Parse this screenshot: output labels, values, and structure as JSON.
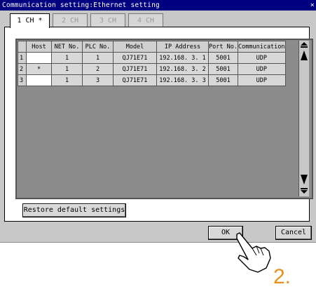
{
  "window": {
    "title": "Communication setting:Ethernet setting",
    "close_glyph": "×"
  },
  "tabs": [
    {
      "label": "1 CH *",
      "active": true
    },
    {
      "label": "2 CH",
      "active": false
    },
    {
      "label": "3 CH",
      "active": false
    },
    {
      "label": "4 CH",
      "active": false
    }
  ],
  "table": {
    "headers": [
      "Host",
      "NET No.",
      "PLC No.",
      "Model",
      "IP Address",
      "Port No.",
      "Communication"
    ],
    "rows": [
      {
        "num": "1",
        "host": "",
        "net": "1",
        "plc": "1",
        "model": "QJ71E71",
        "ip": "192.168.  3.  1",
        "port": "5001",
        "comm": "UDP"
      },
      {
        "num": "2",
        "host": "*",
        "net": "1",
        "plc": "2",
        "model": "QJ71E71",
        "ip": "192.168.  3.  2",
        "port": "5001",
        "comm": "UDP"
      },
      {
        "num": "3",
        "host": "",
        "net": "1",
        "plc": "3",
        "model": "QJ71E71",
        "ip": "192.168.  3.  3",
        "port": "5001",
        "comm": "UDP"
      }
    ]
  },
  "buttons": {
    "restore": "Restore default settings",
    "ok": "OK",
    "cancel": "Cancel"
  },
  "annotation": {
    "step": "2."
  },
  "colors": {
    "titlebar": "#000080",
    "grid_background": "#8c8c8c",
    "step_number": "#e8911a"
  }
}
